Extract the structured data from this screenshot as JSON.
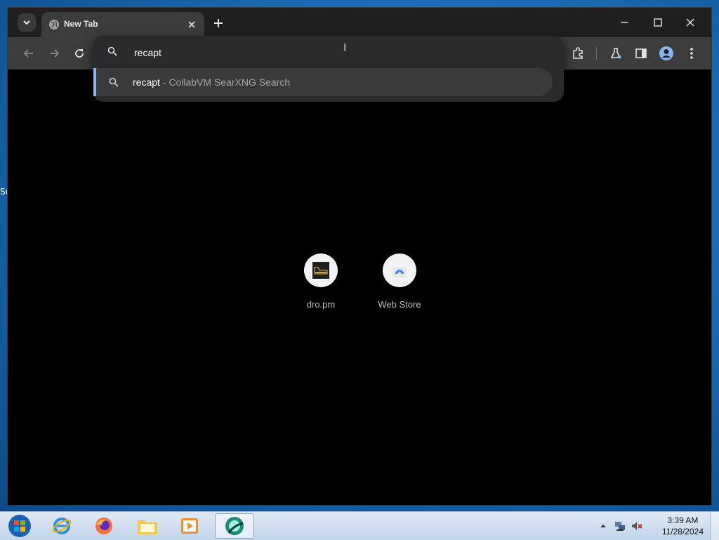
{
  "browser": {
    "tab": {
      "title": "New Tab"
    },
    "omnibox": {
      "value": "recapt",
      "suggestion": {
        "query": "recapt",
        "separator": " - ",
        "provider": "CollabVM SearXNG Search"
      }
    },
    "shortcuts": [
      {
        "label": "dro.pm"
      },
      {
        "label": "Web Store"
      }
    ]
  },
  "desktop": {
    "fragment_label": "Su"
  },
  "taskbar": {
    "clock": {
      "time": "3:39 AM",
      "date": "11/28/2024"
    }
  },
  "colors": {
    "tab_active": "#3c3c3c",
    "toolbar": "#3c3c3c",
    "titlebar": "#1f1f1f",
    "accent": "#8ab4f8",
    "page_bg": "#000000"
  }
}
